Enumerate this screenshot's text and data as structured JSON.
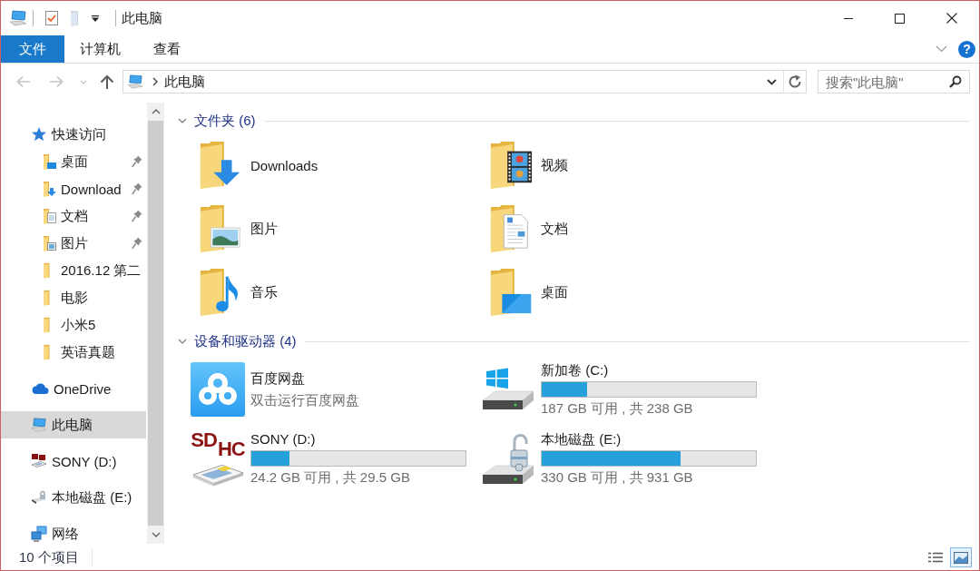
{
  "window": {
    "title": "此电脑"
  },
  "ribbon": {
    "tabs": [
      {
        "label": "文件",
        "kind": "file"
      },
      {
        "label": "计算机",
        "kind": "tab"
      },
      {
        "label": "查看",
        "kind": "tab"
      }
    ],
    "help": "?"
  },
  "address_bar": {
    "nav_buttons": [
      {
        "kind": "back",
        "disabled": true
      },
      {
        "kind": "forward",
        "disabled": true
      },
      {
        "kind": "recent",
        "disabled": true
      },
      {
        "kind": "up",
        "disabled": false
      }
    ],
    "path": [
      "此电脑"
    ],
    "search": {
      "placeholder": "搜索\"此电脑\""
    }
  },
  "navigation_pane": {
    "items": [
      {
        "label": "快速访问",
        "kind": "quickaccess",
        "selected": false,
        "children": [
          {
            "label": "桌面",
            "kind": "desktop",
            "pinned": true,
            "selected": false
          },
          {
            "label": "Download",
            "kind": "downloads",
            "pinned": true,
            "selected": false
          },
          {
            "label": "文档",
            "kind": "documents",
            "pinned": true,
            "selected": false
          },
          {
            "label": "图片",
            "kind": "pictures",
            "pinned": true,
            "selected": false
          },
          {
            "label": "2016.12 第二",
            "kind": "folder",
            "pinned": false,
            "selected": false
          },
          {
            "label": "电影",
            "kind": "folder",
            "pinned": false,
            "selected": false
          },
          {
            "label": "小米5",
            "kind": "folder",
            "pinned": false,
            "selected": false
          },
          {
            "label": "英语真题",
            "kind": "folder",
            "pinned": false,
            "selected": false
          }
        ]
      },
      {
        "label": "OneDrive",
        "kind": "onedrive",
        "selected": false
      },
      {
        "label": "此电脑",
        "kind": "computer",
        "selected": true
      },
      {
        "label": "SONY (D:)",
        "kind": "sdcard",
        "selected": false
      },
      {
        "label": "本地磁盘 (E:)",
        "kind": "bitlocker",
        "selected": false
      },
      {
        "label": "网络",
        "kind": "network",
        "selected": false
      }
    ]
  },
  "folders": {
    "header": "文件夹 (6)",
    "expanded": true,
    "items": [
      {
        "name": "Downloads",
        "kind": "downloads"
      },
      {
        "name": "视频",
        "kind": "videos"
      },
      {
        "name": "图片",
        "kind": "pictures"
      },
      {
        "name": "文档",
        "kind": "documents"
      },
      {
        "name": "音乐",
        "kind": "music"
      },
      {
        "name": "桌面",
        "kind": "desktop"
      }
    ]
  },
  "devices": {
    "header": "设备和驱动器 (4)",
    "expanded": true,
    "items": [
      {
        "kind": "app",
        "name": "百度网盘",
        "subtitle": "双击运行百度网盘"
      },
      {
        "kind": "system",
        "name": "新加卷 (C:)",
        "level": 0.21,
        "space": "187 GB 可用 , 共 238 GB"
      },
      {
        "kind": "sdcard",
        "logo": [
          "SD",
          "HC"
        ],
        "name": "SONY (D:)",
        "level": 0.18,
        "space": "24.2 GB 可用 , 共 29.5 GB"
      },
      {
        "kind": "bitlocker",
        "name": "本地磁盘 (E:)",
        "level": 0.65,
        "space": "330 GB 可用 , 共 931 GB"
      }
    ]
  },
  "status_bar": {
    "item_count": "10 个项目",
    "view_buttons": [
      {
        "kind": "details",
        "selected": false
      },
      {
        "kind": "largeicons",
        "selected": true
      }
    ]
  }
}
